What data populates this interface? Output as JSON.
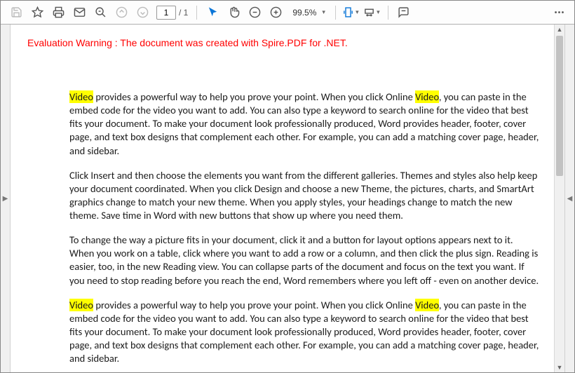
{
  "toolbar": {
    "page_input": "1",
    "page_total": "/ 1",
    "zoom_value": "99.5%"
  },
  "icons": {
    "save": "save-icon",
    "star": "star-icon",
    "print": "print-icon",
    "mail": "mail-icon",
    "find": "find-icon",
    "prev": "prev-page-icon",
    "next": "next-page-icon",
    "pointer": "pointer-icon",
    "hand": "hand-icon",
    "zoom_out": "zoom-out-icon",
    "zoom_in": "zoom-in-icon",
    "fit_page": "fit-page-icon",
    "fit_width": "fit-width-icon",
    "comment": "comment-icon",
    "more": "more-icon"
  },
  "document": {
    "warning": "Evaluation Warning : The document was created with Spire.PDF for .NET.",
    "highlight_word": "Video",
    "paragraphs": [
      {
        "segments": [
          {
            "t": "Video",
            "hl": true
          },
          {
            "t": " provides a powerful way to help you prove your point. When you click Online "
          },
          {
            "t": "Video",
            "hl": true
          },
          {
            "t": ", you can paste in the embed code for the video you want to add. You can also type a keyword to search online for the video that best fits your document. To make your document look professionally produced, Word provides header, footer, cover page, and text box designs that complement each other. For example, you can add a matching cover page, header, and sidebar."
          }
        ]
      },
      {
        "segments": [
          {
            "t": "Click Insert and then choose the elements you want from the different galleries. Themes and styles also help keep your document coordinated. When you click Design and choose a new Theme, the pictures, charts, and SmartArt graphics change to match your new theme. When you apply styles, your headings change to match the new theme. Save time in Word with new buttons that show up where you need them."
          }
        ]
      },
      {
        "segments": [
          {
            "t": "To change the way a picture fits in your document, click it and a button for layout options appears next to it. When you work on a table, click where you want to add a row or a column, and then click the plus sign. Reading is easier, too, in the new Reading view. You can collapse parts of the document and focus on the text you want. If you need to stop reading before you reach the end, Word remembers where you left off - even on another device."
          }
        ]
      },
      {
        "segments": [
          {
            "t": "Video",
            "hl": true
          },
          {
            "t": " provides a powerful way to help you prove your point. When you click Online "
          },
          {
            "t": "Video",
            "hl": true
          },
          {
            "t": ", you can paste in the embed code for the video you want to add. You can also type a keyword to search online for the video that best fits your document. To make your document look professionally produced, Word provides header, footer, cover page, and text box designs that complement each other. For example, you can add a matching cover page, header, and sidebar."
          }
        ]
      }
    ]
  }
}
